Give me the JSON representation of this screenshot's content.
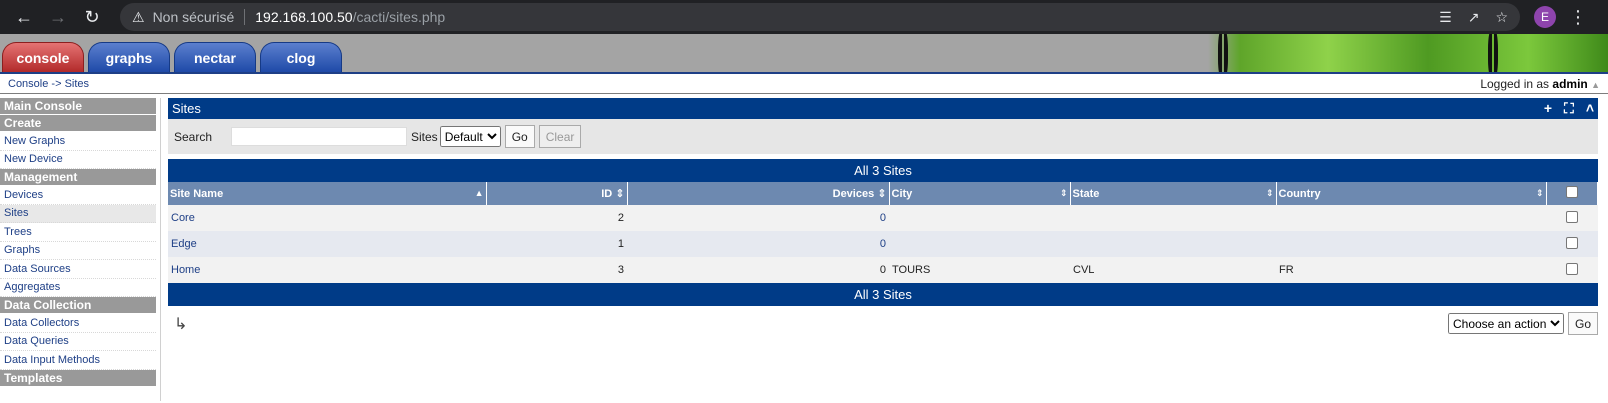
{
  "browser": {
    "not_secure": "Non sécurisé",
    "host": "192.168.100.50",
    "path": "/cacti/sites.php",
    "avatar_letter": "E"
  },
  "tabs": [
    {
      "label": "console",
      "active": true
    },
    {
      "label": "graphs",
      "active": false
    },
    {
      "label": "nectar",
      "active": false
    },
    {
      "label": "clog",
      "active": false
    }
  ],
  "breadcrumb": {
    "home": "Console",
    "sep": "->",
    "current": "Sites"
  },
  "login": {
    "prefix": "Logged in as",
    "user": "admin"
  },
  "sidebar": [
    {
      "type": "head",
      "label": "Main Console"
    },
    {
      "type": "head",
      "label": "Create"
    },
    {
      "type": "item",
      "label": "New Graphs"
    },
    {
      "type": "item",
      "label": "New Device"
    },
    {
      "type": "head",
      "label": "Management"
    },
    {
      "type": "item",
      "label": "Devices"
    },
    {
      "type": "item",
      "label": "Sites",
      "selected": true
    },
    {
      "type": "item",
      "label": "Trees"
    },
    {
      "type": "item",
      "label": "Graphs"
    },
    {
      "type": "item",
      "label": "Data Sources"
    },
    {
      "type": "item",
      "label": "Aggregates"
    },
    {
      "type": "head",
      "label": "Data Collection"
    },
    {
      "type": "item",
      "label": "Data Collectors"
    },
    {
      "type": "item",
      "label": "Data Queries"
    },
    {
      "type": "item",
      "label": "Data Input Methods"
    },
    {
      "type": "head",
      "label": "Templates"
    }
  ],
  "panel": {
    "title": "Sites"
  },
  "filter": {
    "search_label": "Search",
    "search_value": "",
    "sites_label": "Sites",
    "sites_selected": "Default",
    "go": "Go",
    "clear": "Clear"
  },
  "table": {
    "title": "All 3 Sites",
    "footer": "All 3 Sites",
    "columns": [
      "Site Name",
      "ID",
      "Devices",
      "City",
      "State",
      "Country"
    ],
    "rows": [
      {
        "name": "Core",
        "id": "2",
        "devices": "0",
        "city": "",
        "state": "",
        "country": ""
      },
      {
        "name": "Edge",
        "id": "1",
        "devices": "0",
        "city": "",
        "state": "",
        "country": ""
      },
      {
        "name": "Home",
        "id": "3",
        "devices": "0",
        "city": "TOURS",
        "state": "CVL",
        "country": "FR"
      }
    ]
  },
  "actions": {
    "select_value": "Choose an action",
    "go": "Go"
  }
}
